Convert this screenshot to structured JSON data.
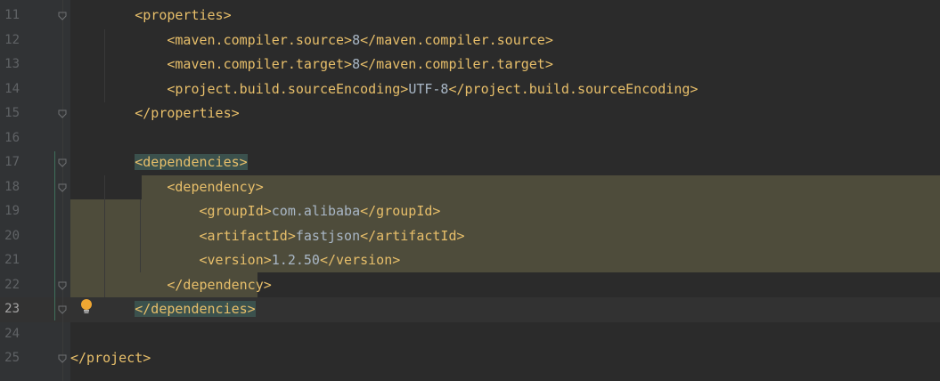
{
  "editor": {
    "lines": [
      {
        "num": "11",
        "indent": "    ",
        "parts": [
          {
            "t": "tag",
            "v": "<properties>"
          }
        ]
      },
      {
        "num": "12",
        "indent": "        ",
        "parts": [
          {
            "t": "tag",
            "v": "<maven.compiler.source>"
          },
          {
            "t": "text",
            "v": "8"
          },
          {
            "t": "tag",
            "v": "</maven.compiler.source>"
          }
        ]
      },
      {
        "num": "13",
        "indent": "        ",
        "parts": [
          {
            "t": "tag",
            "v": "<maven.compiler.target>"
          },
          {
            "t": "text",
            "v": "8"
          },
          {
            "t": "tag",
            "v": "</maven.compiler.target>"
          }
        ]
      },
      {
        "num": "14",
        "indent": "        ",
        "parts": [
          {
            "t": "tag",
            "v": "<project.build.sourceEncoding>"
          },
          {
            "t": "text",
            "v": "UTF-8"
          },
          {
            "t": "tag",
            "v": "</project.build.sourceEncoding>"
          }
        ]
      },
      {
        "num": "15",
        "indent": "    ",
        "parts": [
          {
            "t": "tag",
            "v": "</properties>"
          }
        ]
      },
      {
        "num": "16",
        "indent": "",
        "parts": []
      },
      {
        "num": "17",
        "indent": "    ",
        "parts": [
          {
            "t": "tag",
            "v": "<dependencies>"
          }
        ]
      },
      {
        "num": "18",
        "indent": "        ",
        "parts": [
          {
            "t": "tag",
            "v": "<dependency>"
          }
        ]
      },
      {
        "num": "19",
        "indent": "            ",
        "parts": [
          {
            "t": "tag",
            "v": "<groupId>"
          },
          {
            "t": "text",
            "v": "com.alibaba"
          },
          {
            "t": "tag",
            "v": "</groupId>"
          }
        ]
      },
      {
        "num": "20",
        "indent": "            ",
        "parts": [
          {
            "t": "tag",
            "v": "<artifactId>"
          },
          {
            "t": "text",
            "v": "fastjson"
          },
          {
            "t": "tag",
            "v": "</artifactId>"
          }
        ]
      },
      {
        "num": "21",
        "indent": "            ",
        "parts": [
          {
            "t": "tag",
            "v": "<version>"
          },
          {
            "t": "text",
            "v": "1.2.50"
          },
          {
            "t": "tag",
            "v": "</version>"
          }
        ]
      },
      {
        "num": "22",
        "indent": "        ",
        "parts": [
          {
            "t": "tag",
            "v": "</dependency>"
          }
        ]
      },
      {
        "num": "23",
        "indent": "    ",
        "parts": [
          {
            "t": "tag",
            "v": "</dependencies>"
          }
        ]
      },
      {
        "num": "24",
        "indent": "",
        "parts": []
      },
      {
        "num": "25",
        "indent": "",
        "parts": [
          {
            "t": "tag",
            "v": "</project>"
          }
        ]
      }
    ],
    "current_line": "23",
    "fold_lines": [
      "11",
      "15",
      "17",
      "18",
      "22",
      "23",
      "25"
    ],
    "colors": {
      "tag": "#e8bf6a",
      "text": "#a9b7c6",
      "selection": "#4e4c3b",
      "brace_match": "#3b514d",
      "background": "#2b2b2b",
      "gutter": "#313335"
    },
    "intention_icon": "lightbulb-icon"
  }
}
